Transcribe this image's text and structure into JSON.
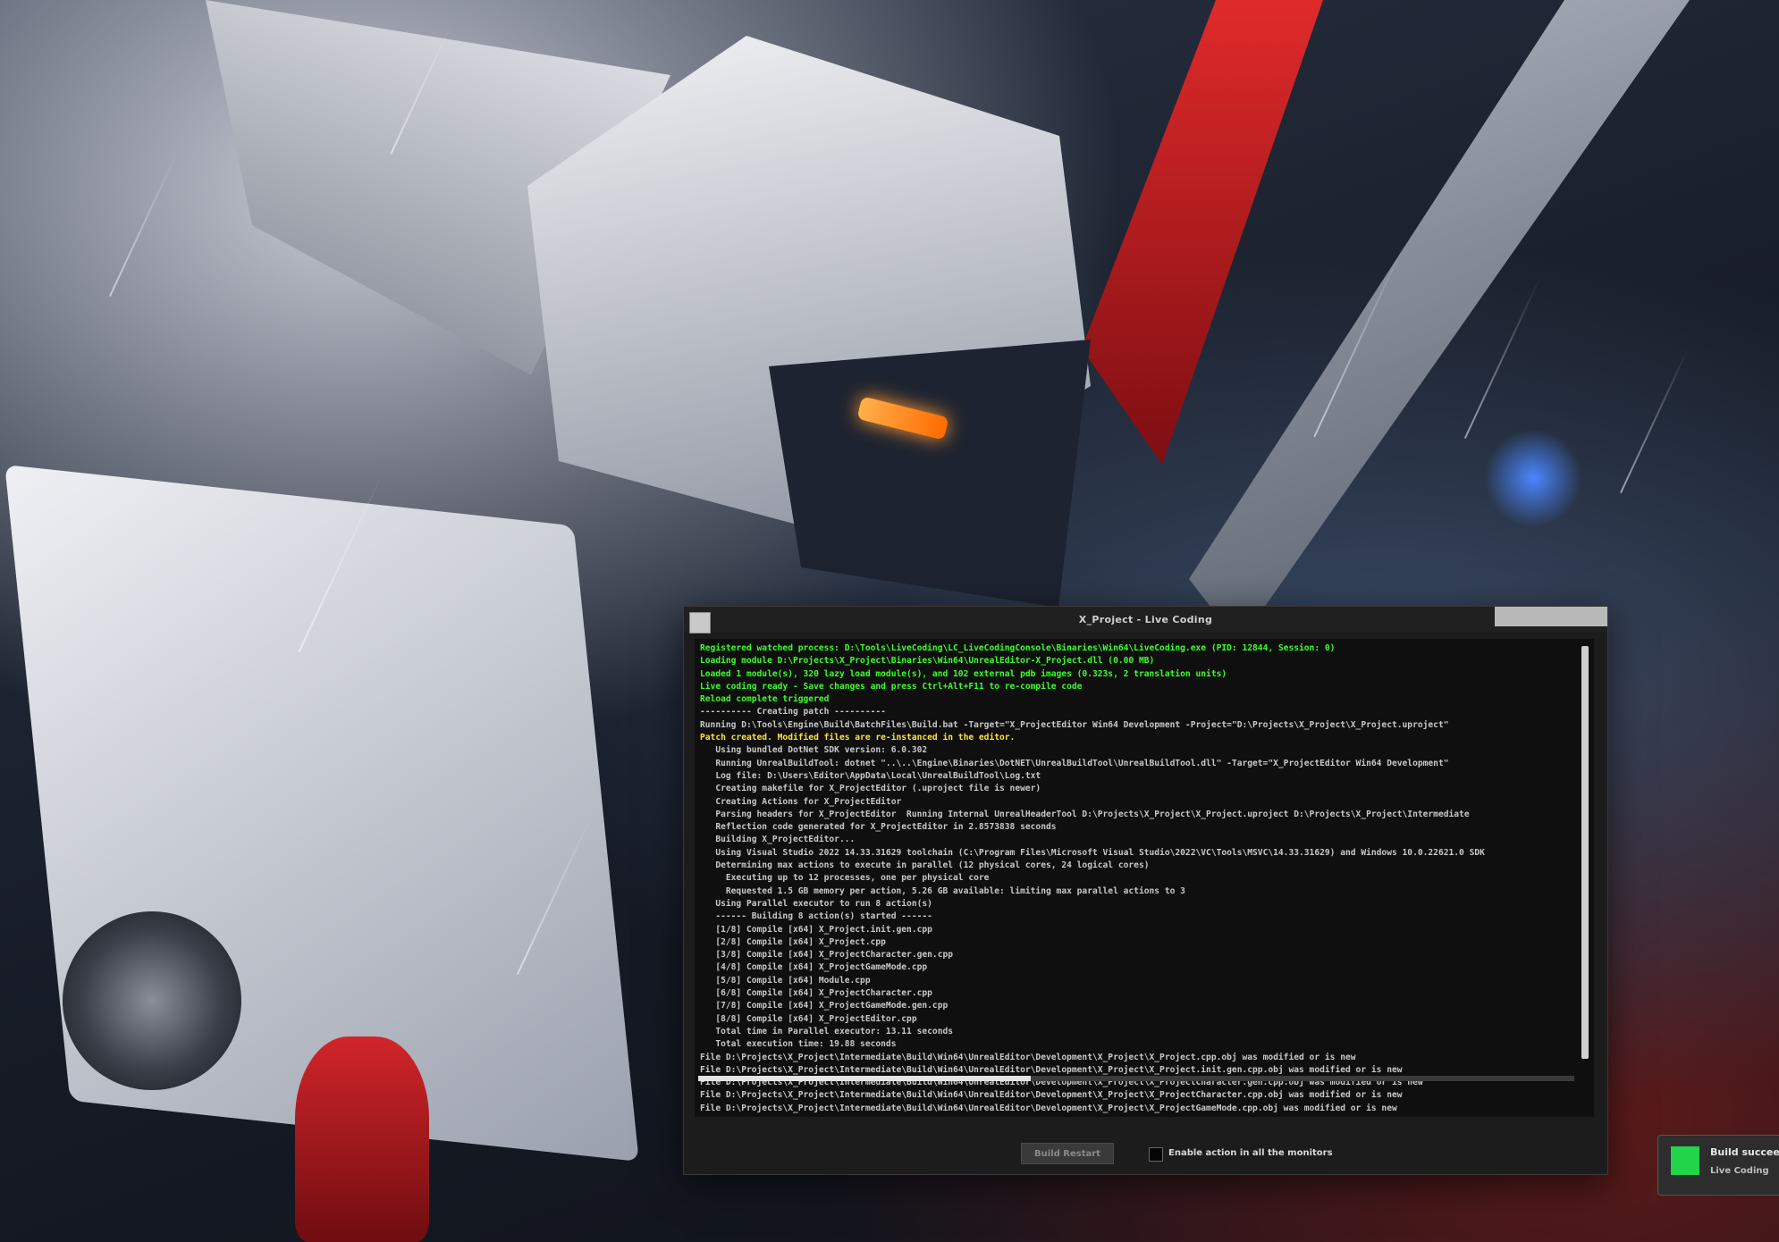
{
  "window": {
    "title": "X_Project - Live Coding",
    "build_button": "Build Restart",
    "auto_restart_label": "Enable action in all the monitors"
  },
  "log_lines": [
    {
      "style": "g",
      "text": "Registered watched process: D:\\Tools\\LiveCoding\\LC_LiveCodingConsole\\Binaries\\Win64\\LiveCoding.exe (PID: 12844, Session: 0)"
    },
    {
      "style": "g",
      "text": "Loading module D:\\Projects\\X_Project\\Binaries\\Win64\\UnrealEditor-X_Project.dll (0.00 MB)"
    },
    {
      "style": "g",
      "text": "Loaded 1 module(s), 320 lazy load module(s), and 102 external pdb images (0.323s, 2 translation units)"
    },
    {
      "style": "g",
      "text": "Live coding ready - Save changes and press Ctrl+Alt+F11 to re-compile code"
    },
    {
      "style": "g",
      "text": "Reload complete triggered"
    },
    {
      "style": "w",
      "text": "---------- Creating patch ----------"
    },
    {
      "style": "w",
      "text": "Running D:\\Tools\\Engine\\Build\\BatchFiles\\Build.bat -Target=\"X_ProjectEditor Win64 Development -Project=\"D:\\Projects\\X_Project\\X_Project.uproject\""
    },
    {
      "style": "y",
      "text": "Patch created. Modified files are re-instanced in the editor."
    },
    {
      "style": "w",
      "text": "   Using bundled DotNet SDK version: 6.0.302"
    },
    {
      "style": "w",
      "text": "   Running UnrealBuildTool: dotnet \"..\\..\\Engine\\Binaries\\DotNET\\UnrealBuildTool\\UnrealBuildTool.dll\" -Target=\"X_ProjectEditor Win64 Development\""
    },
    {
      "style": "w",
      "text": "   Log file: D:\\Users\\Editor\\AppData\\Local\\UnrealBuildTool\\Log.txt"
    },
    {
      "style": "w",
      "text": "   Creating makefile for X_ProjectEditor (.uproject file is newer)"
    },
    {
      "style": "w",
      "text": "   Creating Actions for X_ProjectEditor"
    },
    {
      "style": "w",
      "text": "   Parsing headers for X_ProjectEditor  Running Internal UnrealHeaderTool D:\\Projects\\X_Project\\X_Project.uproject D:\\Projects\\X_Project\\Intermediate"
    },
    {
      "style": "w",
      "text": "   Reflection code generated for X_ProjectEditor in 2.8573838 seconds"
    },
    {
      "style": "w",
      "text": "   Building X_ProjectEditor..."
    },
    {
      "style": "w",
      "text": "   Using Visual Studio 2022 14.33.31629 toolchain (C:\\Program Files\\Microsoft Visual Studio\\2022\\VC\\Tools\\MSVC\\14.33.31629) and Windows 10.0.22621.0 SDK"
    },
    {
      "style": "w",
      "text": "   Determining max actions to execute in parallel (12 physical cores, 24 logical cores)"
    },
    {
      "style": "w",
      "text": "     Executing up to 12 processes, one per physical core"
    },
    {
      "style": "w",
      "text": "     Requested 1.5 GB memory per action, 5.26 GB available: limiting max parallel actions to 3"
    },
    {
      "style": "w",
      "text": "   Using Parallel executor to run 8 action(s)"
    },
    {
      "style": "w",
      "text": "   ------ Building 8 action(s) started ------"
    },
    {
      "style": "w",
      "text": "   [1/8] Compile [x64] X_Project.init.gen.cpp"
    },
    {
      "style": "w",
      "text": "   [2/8] Compile [x64] X_Project.cpp"
    },
    {
      "style": "w",
      "text": "   [3/8] Compile [x64] X_ProjectCharacter.gen.cpp"
    },
    {
      "style": "w",
      "text": "   [4/8] Compile [x64] X_ProjectGameMode.cpp"
    },
    {
      "style": "w",
      "text": "   [5/8] Compile [x64] Module.cpp"
    },
    {
      "style": "w",
      "text": "   [6/8] Compile [x64] X_ProjectCharacter.cpp"
    },
    {
      "style": "w",
      "text": "   [7/8] Compile [x64] X_ProjectGameMode.gen.cpp"
    },
    {
      "style": "w",
      "text": "   [8/8] Compile [x64] X_ProjectEditor.cpp"
    },
    {
      "style": "w",
      "text": "   Total time in Parallel executor: 13.11 seconds"
    },
    {
      "style": "w",
      "text": "   Total execution time: 19.88 seconds"
    },
    {
      "style": "w",
      "text": "File D:\\Projects\\X_Project\\Intermediate\\Build\\Win64\\UnrealEditor\\Development\\X_Project\\X_Project.cpp.obj was modified or is new"
    },
    {
      "style": "w",
      "text": "File D:\\Projects\\X_Project\\Intermediate\\Build\\Win64\\UnrealEditor\\Development\\X_Project\\X_Project.init.gen.cpp.obj was modified or is new"
    },
    {
      "style": "w",
      "text": "File D:\\Projects\\X_Project\\Intermediate\\Build\\Win64\\UnrealEditor\\Development\\X_Project\\X_ProjectCharacter.gen.cpp.obj was modified or is new"
    },
    {
      "style": "w",
      "text": "File D:\\Projects\\X_Project\\Intermediate\\Build\\Win64\\UnrealEditor\\Development\\X_Project\\X_ProjectCharacter.cpp.obj was modified or is new"
    },
    {
      "style": "w",
      "text": "File D:\\Projects\\X_Project\\Intermediate\\Build\\Win64\\UnrealEditor\\Development\\X_Project\\X_ProjectGameMode.cpp.obj was modified or is new"
    }
  ],
  "toast": {
    "title": "Build succeeded",
    "subtitle": "Live Coding"
  },
  "colors": {
    "log_green": "#3bff2a",
    "log_yellow": "#ffe23a",
    "log_default": "#c8c8c8",
    "toast_icon": "#21d44a"
  }
}
